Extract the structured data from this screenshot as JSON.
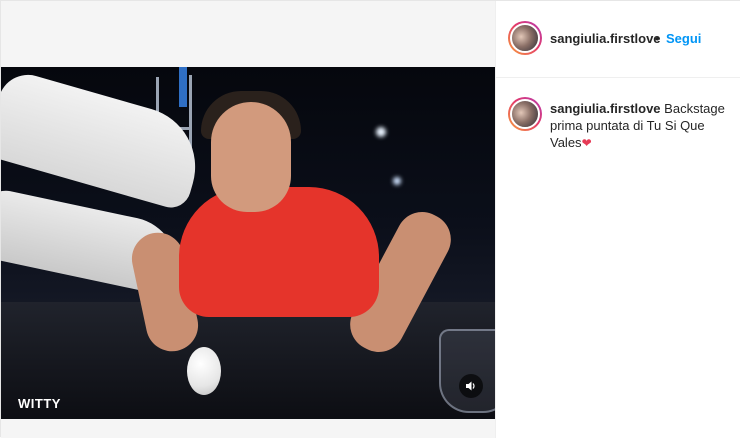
{
  "post": {
    "video": {
      "watermark": "WITTY",
      "mute_icon": "speaker-icon"
    },
    "header": {
      "username": "sangiulia.firstlove",
      "separator": "•",
      "follow_label": "Segui"
    },
    "caption": {
      "username": "sangiulia.firstlove",
      "text": "Backstage prima puntata di Tu Si Que Vales",
      "emoji": "❤"
    }
  },
  "colors": {
    "follow_blue": "#0095f6",
    "text_dark": "#262626",
    "shirt_red": "#e5342b"
  }
}
